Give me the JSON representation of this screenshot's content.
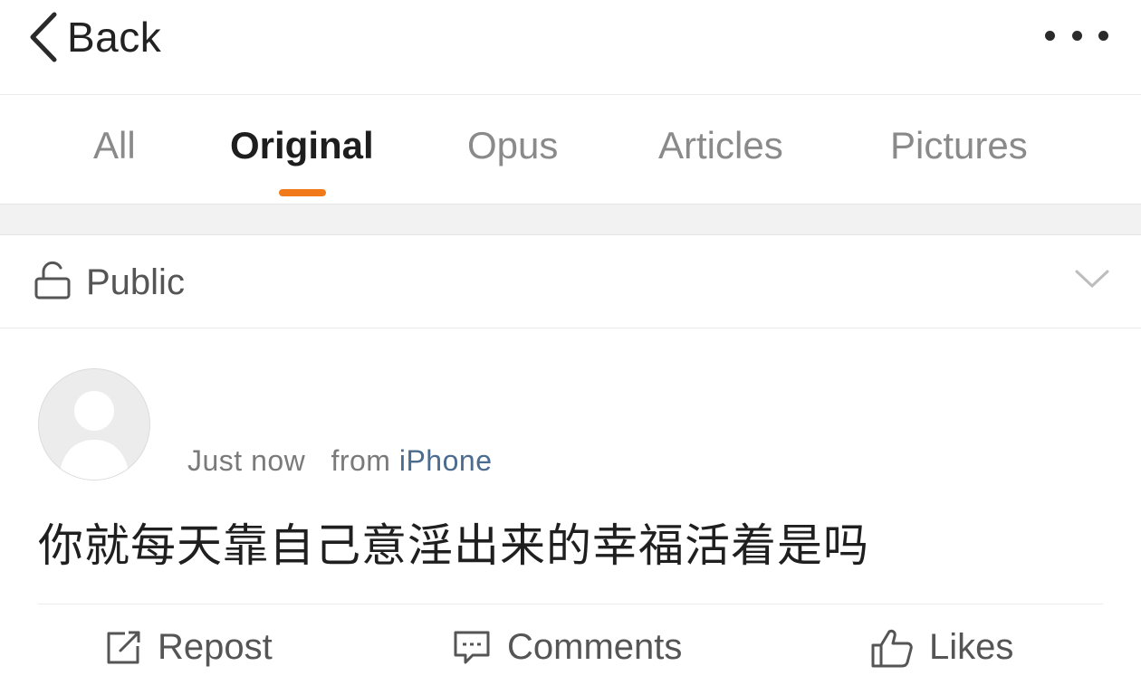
{
  "navbar": {
    "back_label": "Back"
  },
  "tabs": [
    {
      "label": "All"
    },
    {
      "label": "Original"
    },
    {
      "label": "Opus"
    },
    {
      "label": "Articles"
    },
    {
      "label": "Pictures"
    }
  ],
  "active_tab": "Original",
  "visibility": {
    "label": "Public"
  },
  "post": {
    "time": "Just now",
    "from_prefix": "from",
    "source": "iPhone",
    "text": "你就每天靠自己意淫出来的幸福活着是吗"
  },
  "actions": {
    "repost_label": "Repost",
    "comments_label": "Comments",
    "likes_label": "Likes"
  },
  "colors": {
    "accent": "#f07a1a",
    "source_link": "#4b6b8f",
    "inactive_tab": "#8a8a8a"
  },
  "icons": {
    "back": "chevron-left-icon",
    "more": "more-dots-icon",
    "visibility": "unlock-icon",
    "expand": "chevron-down-icon",
    "avatar": "default-avatar-icon",
    "repost": "repost-icon",
    "comments": "comment-icon",
    "likes": "thumbs-up-icon"
  }
}
